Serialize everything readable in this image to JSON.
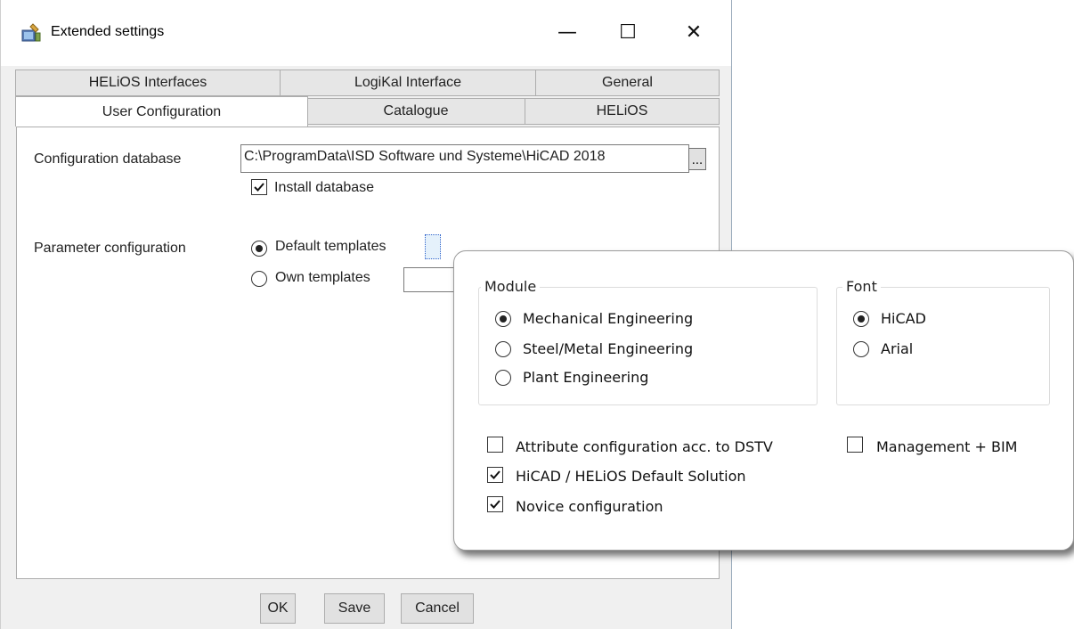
{
  "window": {
    "title": "Extended settings",
    "minimize_glyph": "—",
    "maximize_glyph": "☐",
    "close_glyph": "✕"
  },
  "tabs": {
    "row_back": [
      "HELiOS Interfaces",
      "LogiKal Interface",
      "General"
    ],
    "row_front": [
      "User Configuration",
      "Catalogue",
      "HELiOS"
    ],
    "active": "User Configuration"
  },
  "user_configuration": {
    "config_db_label": "Configuration database",
    "config_db_value": "C:\\ProgramData\\ISD Software und Systeme\\HiCAD 2018",
    "browse_label": "...",
    "install_db_label": "Install database",
    "install_db_checked": true,
    "param_config_label": "Parameter configuration",
    "default_templates_label": "Default templates",
    "own_templates_label": "Own templates",
    "own_templates_value": "",
    "selected_template": "Default templates"
  },
  "buttons": {
    "ok": "OK",
    "save": "Save",
    "cancel": "Cancel"
  },
  "popup": {
    "module_title": "Module",
    "modules": [
      "Mechanical Engineering",
      "Steel/Metal Engineering",
      "Plant Engineering"
    ],
    "module_selected": "Mechanical Engineering",
    "font_title": "Font",
    "fonts": [
      "HiCAD",
      "Arial"
    ],
    "font_selected": "HiCAD",
    "attr_dstv_label": "Attribute configuration acc. to DSTV",
    "attr_dstv_checked": false,
    "management_bim_label": "Management + BIM",
    "management_bim_checked": false,
    "default_solution_label": "HiCAD / HELiOS Default Solution",
    "default_solution_checked": true,
    "novice_label": "Novice configuration",
    "novice_checked": true
  },
  "colors": {
    "accent": "#0078d7",
    "focus": "#3366cc"
  }
}
